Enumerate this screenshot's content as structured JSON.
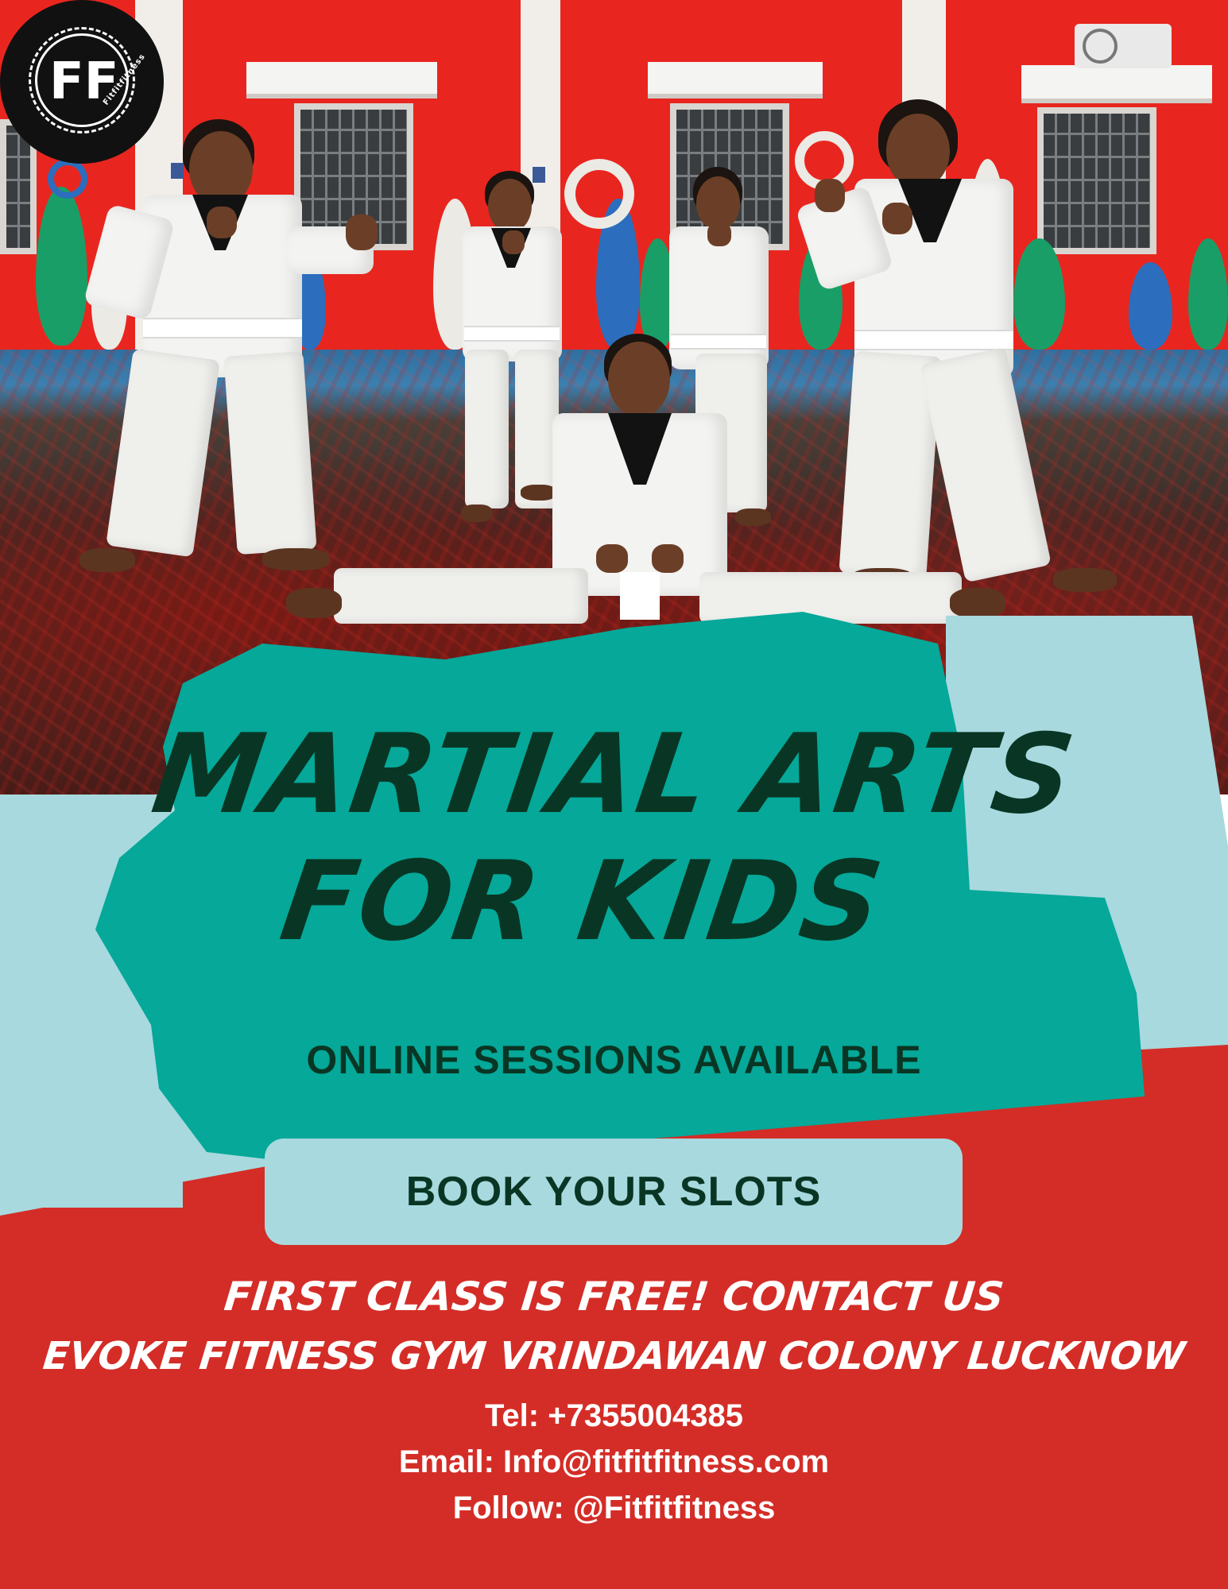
{
  "brand": {
    "logo_letters": "FF",
    "logo_text": "Fitfitfitness"
  },
  "headline": {
    "line1": "MARTIAL ARTS",
    "line2": "FOR KIDS"
  },
  "subheadline": "ONLINE SESSIONS AVAILABLE",
  "cta": {
    "label": "BOOK YOUR SLOTS"
  },
  "promo": {
    "line1": "FIRST CLASS IS FREE! CONTACT US",
    "line2": "EVOKE FITNESS GYM VRINDAWAN COLONY LUCKNOW"
  },
  "contact": {
    "tel": "Tel: +7355004385",
    "email": "Email: Info@fitfitfitness.com",
    "follow": "Follow: @Fitfitfitness"
  },
  "colors": {
    "red": "#d42d27",
    "teal": "#05a899",
    "light_blue": "#a8d9de",
    "dark_green_text": "#093624",
    "white": "#ffffff"
  },
  "photo": {
    "subject": "kids-in-martial-arts-uniforms"
  }
}
